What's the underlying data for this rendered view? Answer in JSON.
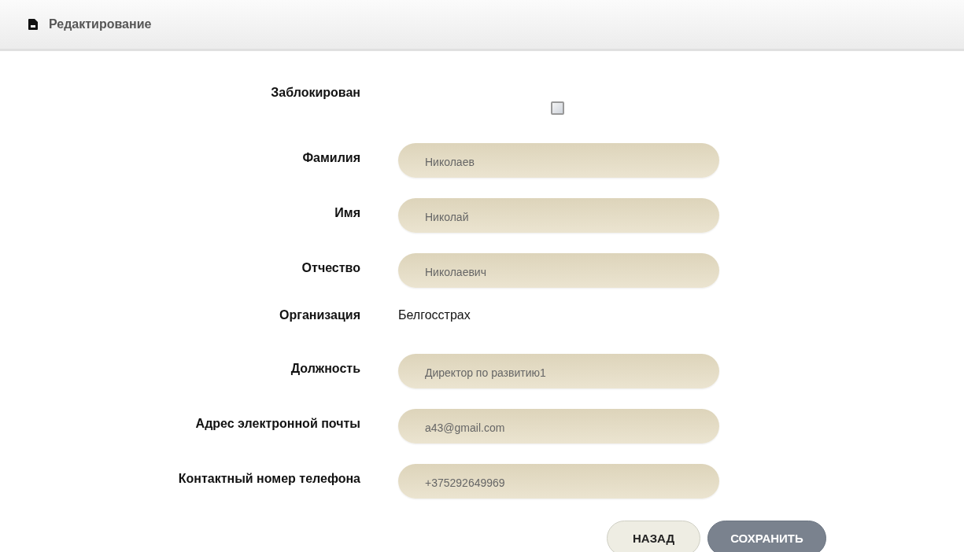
{
  "header": {
    "title": "Редактирование"
  },
  "fields": [
    {
      "kind": "checkbox",
      "label": "Заблокирован",
      "checked": false
    },
    {
      "kind": "input",
      "label": "Фамилия",
      "value": "Николаев"
    },
    {
      "kind": "input",
      "label": "Имя",
      "value": "Николай"
    },
    {
      "kind": "input",
      "label": "Отчество",
      "value": "Николаевич"
    },
    {
      "kind": "text",
      "label": "Организация",
      "value": "Белгосстрах"
    },
    {
      "kind": "input",
      "label": "Должность",
      "value": "Директор по развитию1"
    },
    {
      "kind": "input",
      "label": "Адрес электронной почты",
      "value": "a43@gmail.com"
    },
    {
      "kind": "input",
      "label": "Контактный номер телефона",
      "value": "+375292649969"
    }
  ],
  "buttons": [
    {
      "kind": "secondary",
      "label": "НАЗАД"
    },
    {
      "kind": "primary",
      "label": "СОХРАНИТЬ"
    }
  ]
}
